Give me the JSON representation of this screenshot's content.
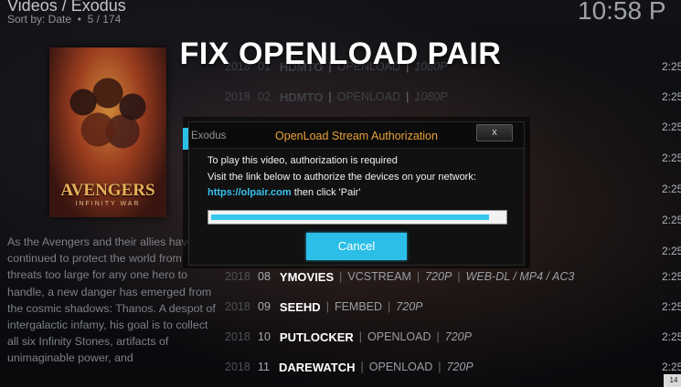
{
  "header": {
    "path": "Videos / Exodus",
    "sort_by": "Sort by: Date",
    "position": "5 / 174",
    "clock": "10:58 P"
  },
  "banner": "FIX OPENLOAD PAIR",
  "poster": {
    "title": "AVENGERS",
    "subtitle": "INFINITY WAR"
  },
  "plot": "As the Avengers and their allies have continued to protect the world from threats too large for any one hero to handle, a new danger has emerged from the cosmic shadows: Thanos. A despot of intergalactic infamy, his goal is to collect all six Infinity Stones, artifacts of unimaginable power, and",
  "sources": [
    {
      "year": "2018",
      "num": "01",
      "host": "HDMTO",
      "source": "OPENLOAD",
      "quality": "1080P",
      "time": "2:25"
    },
    {
      "year": "2018",
      "num": "02",
      "host": "HDMTO",
      "source": "OPENLOAD",
      "quality": "1080P",
      "time": "2:25"
    },
    {
      "year": "",
      "num": "",
      "host": "",
      "source": "",
      "quality": "",
      "time": "2:25"
    },
    {
      "year": "",
      "num": "",
      "host": "",
      "source": "",
      "quality": "",
      "time": "2:25"
    },
    {
      "year": "",
      "num": "",
      "host": "",
      "source": "",
      "quality": "",
      "time": "2:25"
    },
    {
      "year": "",
      "num": "",
      "host": "",
      "source": "",
      "quality": "",
      "time": "2:25"
    },
    {
      "year": "",
      "num": "",
      "host": "",
      "source": "",
      "quality": "",
      "time": "2:25"
    },
    {
      "year": "2018",
      "num": "08",
      "host": "YMOVIES",
      "source": "VCSTREAM",
      "quality": "720P",
      "extra": "WEB-DL / MP4 / AC3",
      "time": "2:25"
    },
    {
      "year": "2018",
      "num": "09",
      "host": "SEEHD",
      "source": "FEMBED",
      "quality": "720P",
      "time": "2:25"
    },
    {
      "year": "2018",
      "num": "10",
      "host": "PUTLOCKER",
      "source": "OPENLOAD",
      "quality": "720P",
      "time": "2:25"
    },
    {
      "year": "2018",
      "num": "11",
      "host": "DAREWATCH",
      "source": "OPENLOAD",
      "quality": "720P",
      "time": "2:25"
    }
  ],
  "side_badge": "14",
  "dialog": {
    "ghost_label": "Exodus",
    "title": "OpenLoad Stream Authorization",
    "close_label": "x",
    "line1": "To play this video, authorization is required",
    "line2": "Visit the link below to authorize the devices on your network:",
    "link": "https://olpair.com",
    "line3_suffix": " then click 'Pair'",
    "progress": 0.95,
    "cancel_label": "Cancel",
    "accent": "#2bbfe8",
    "title_color": "#e8a13b"
  }
}
